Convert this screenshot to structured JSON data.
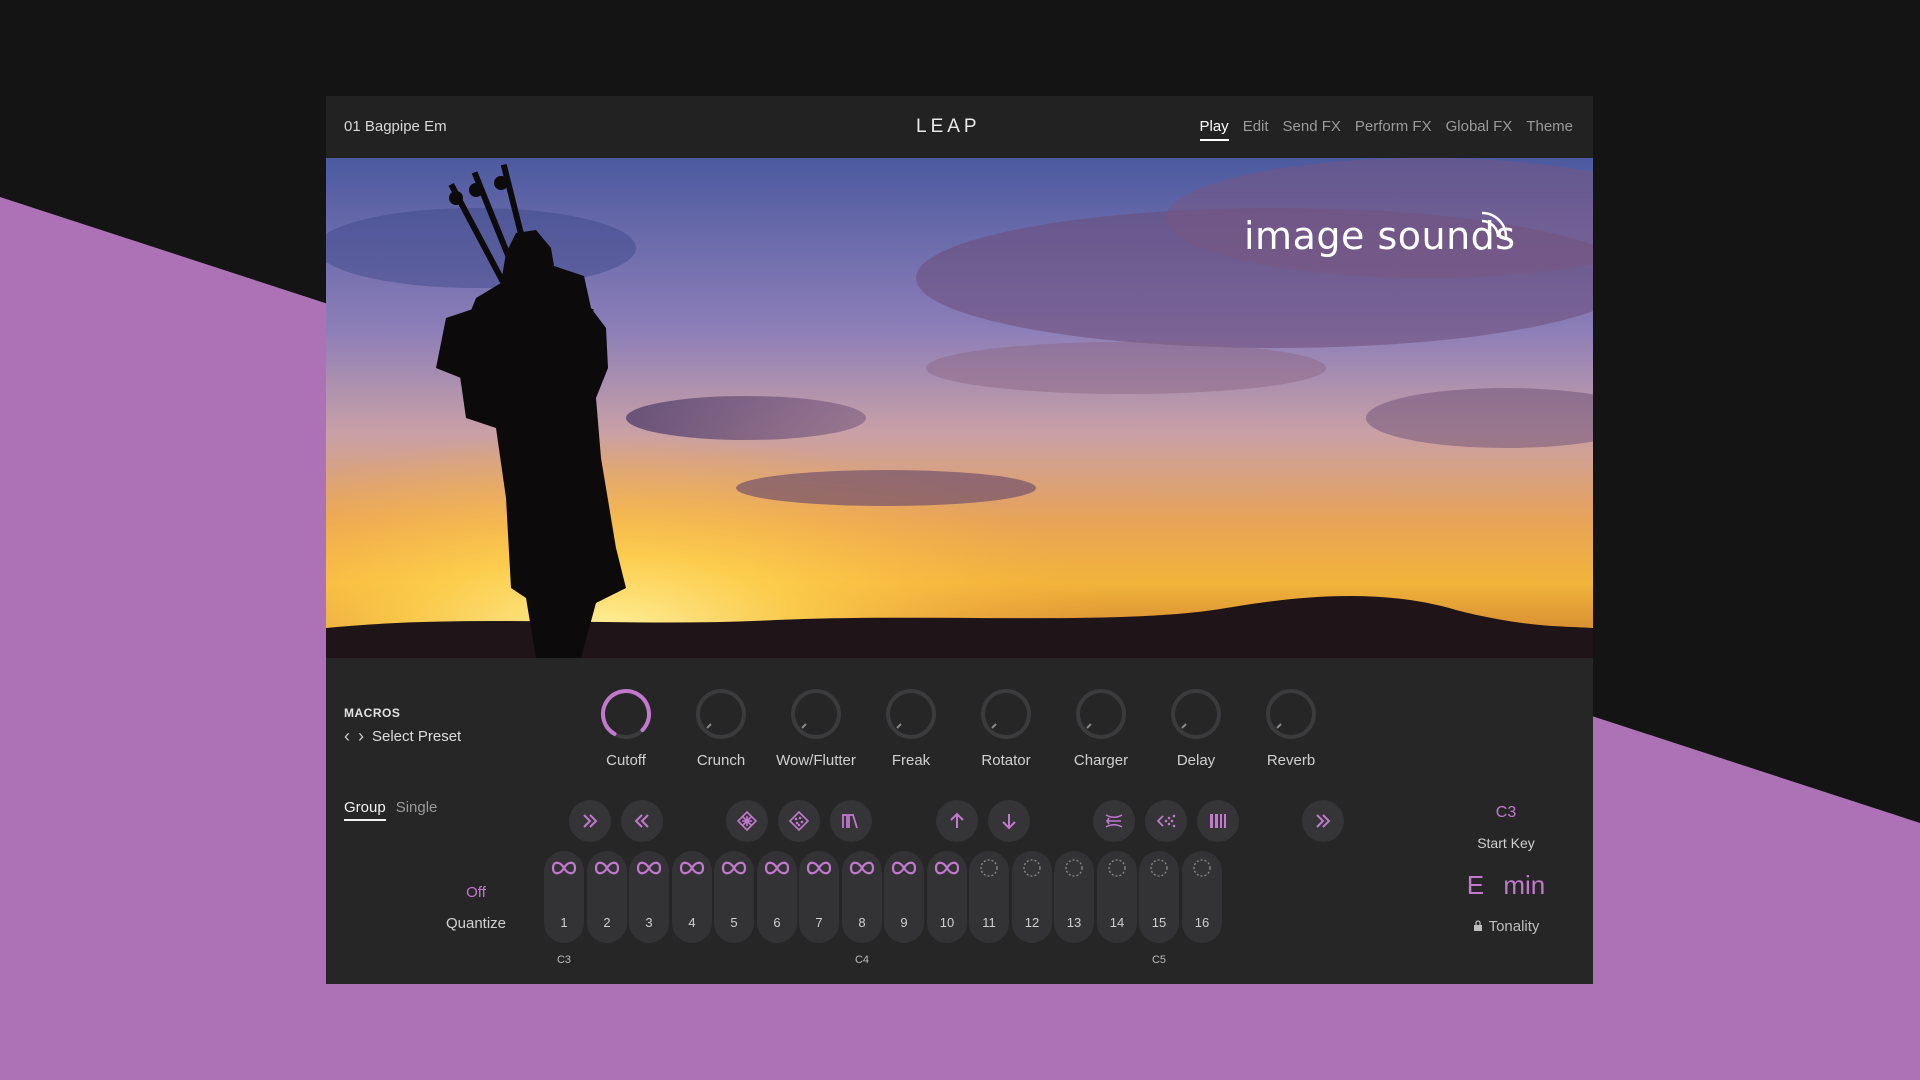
{
  "header": {
    "preset_name": "01 Bagpipe Em",
    "logo": "LEAP",
    "tabs": [
      {
        "label": "Play",
        "active": true
      },
      {
        "label": "Edit",
        "active": false
      },
      {
        "label": "Send FX",
        "active": false
      },
      {
        "label": "Perform FX",
        "active": false
      },
      {
        "label": "Global FX",
        "active": false
      },
      {
        "label": "Theme",
        "active": false
      }
    ]
  },
  "hero": {
    "brand_text": "image sounds"
  },
  "macros": {
    "title": "MACROS",
    "select_preset_label": "Select Preset",
    "knobs": [
      {
        "label": "Cutoff",
        "value": 0.95,
        "active": true
      },
      {
        "label": "Crunch",
        "value": 0,
        "active": false
      },
      {
        "label": "Wow/Flutter",
        "value": 0,
        "active": false
      },
      {
        "label": "Freak",
        "value": 0,
        "active": false
      },
      {
        "label": "Rotator",
        "value": 0,
        "active": false
      },
      {
        "label": "Charger",
        "value": 0,
        "active": false
      },
      {
        "label": "Delay",
        "value": 0,
        "active": false
      },
      {
        "label": "Reverb",
        "value": 0,
        "active": false
      }
    ]
  },
  "mode": {
    "group_label": "Group",
    "single_label": "Single",
    "selected": "Group"
  },
  "quantize": {
    "value": "Off",
    "label": "Quantize"
  },
  "fx_buttons": [
    "fast-forward-icon",
    "rewind-icon",
    "diamond-grid-icon",
    "diamond-scatter-icon",
    "stutter-wave-icon",
    "pitch-up-icon",
    "pitch-down-icon",
    "tape-stop-icon",
    "scatter-left-icon",
    "bars-icon",
    "skip-forward-icon"
  ],
  "pads": {
    "numbers": [
      "1",
      "2",
      "3",
      "4",
      "5",
      "6",
      "7",
      "8",
      "9",
      "10",
      "11",
      "12",
      "13",
      "14",
      "15",
      "16"
    ],
    "loop_count": 10,
    "octave_labels": [
      {
        "pad": 1,
        "label": "C3"
      },
      {
        "pad": 8,
        "label": "C4"
      },
      {
        "pad": 15,
        "label": "C5"
      }
    ]
  },
  "start_key": {
    "value": "C3",
    "label": "Start Key"
  },
  "tonality": {
    "value": "E  min",
    "label": "Tonality"
  },
  "colors": {
    "accent": "#c178cd",
    "panel": "#262627",
    "background": "#ad72b5"
  }
}
